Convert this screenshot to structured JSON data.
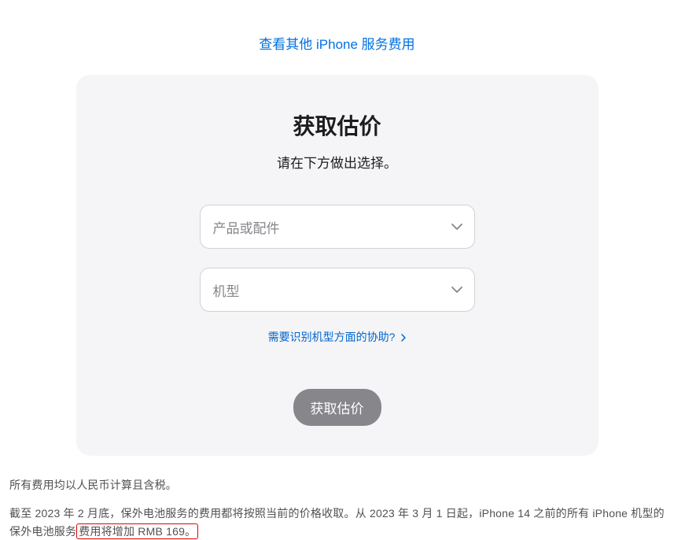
{
  "top_link": "查看其他 iPhone 服务费用",
  "card": {
    "title": "获取估价",
    "subtitle": "请在下方做出选择。",
    "select_product_placeholder": "产品或配件",
    "select_model_placeholder": "机型",
    "help_link": "需要识别机型方面的协助?",
    "button_label": "获取估价"
  },
  "footer": {
    "line1": "所有费用均以人民币计算且含税。",
    "line2_part1": "截至 2023 年 2 月底，保外电池服务的费用都将按照当前的价格收取。从 2023 年 3 月 1 日起，iPhone 14 之前的所有 iPhone 机型的保外电池服务",
    "line2_highlight": "费用将增加 RMB 169。"
  }
}
